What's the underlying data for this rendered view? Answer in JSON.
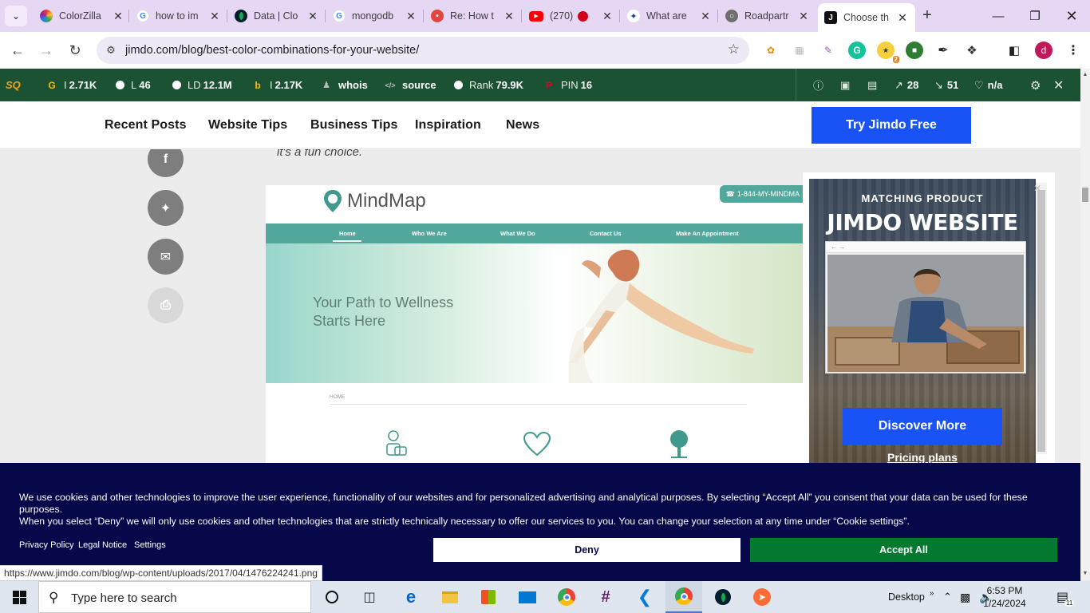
{
  "browser": {
    "tabs": [
      {
        "title": "ColorZilla",
        "icon": "colorzilla-icon",
        "color": "#8b3fd6"
      },
      {
        "title": "how to im",
        "icon": "google-icon",
        "color": "#4285f4"
      },
      {
        "title": "Data | Clo",
        "icon": "mongodb-leaf-icon",
        "color": "#13aa52"
      },
      {
        "title": "mongodb",
        "icon": "google-icon",
        "color": "#4285f4"
      },
      {
        "title": "Re: How t",
        "icon": "community-icon",
        "color": "#e3463c"
      },
      {
        "title": "(270)",
        "icon": "youtube-icon",
        "color": "#ff0000"
      },
      {
        "title": "What are",
        "icon": "roadpartner-icon",
        "color": "#1b3f8b"
      },
      {
        "title": "Roadpartr",
        "icon": "globe-icon",
        "color": "#5f6368"
      },
      {
        "title": "Choose th",
        "icon": "jimdo-icon",
        "color": "#111111",
        "active": true
      }
    ],
    "url": "jimdo.com/blog/best-color-combinations-for-your-website/",
    "profile_initial": "d",
    "status_url": "https://www.jimdo.com/blog/wp-content/uploads/2017/04/1476224241.png"
  },
  "seoquake": {
    "logo": "SQ",
    "items": [
      {
        "icon": "google-icon",
        "label": "I",
        "value": "2.71K"
      },
      {
        "icon": "link-icon",
        "label": "L",
        "value": "46"
      },
      {
        "icon": "link-domain-icon",
        "label": "LD",
        "value": "12.1M"
      },
      {
        "icon": "bing-icon",
        "label": "I",
        "value": "2.17K"
      },
      {
        "icon": "whois-icon",
        "label": "whois",
        "value": ""
      },
      {
        "icon": "source-icon",
        "label": "source",
        "value": ""
      },
      {
        "icon": "rank-icon",
        "label": "Rank",
        "value": "79.9K"
      },
      {
        "icon": "pinterest-icon",
        "label": "PIN",
        "value": "16"
      }
    ],
    "right": {
      "external_links": "28",
      "internal_links": "51",
      "rating": "n/a"
    }
  },
  "site": {
    "nav": [
      "Recent Posts",
      "Website Tips",
      "Business Tips",
      "Inspiration",
      "News"
    ],
    "cta": "Try Jimdo Free",
    "intro_text": "it's a fun choice.",
    "share": [
      "facebook",
      "twitter",
      "email",
      "print"
    ]
  },
  "mindmap": {
    "logo": "MindMap",
    "phone": "1-844-MY-MINDMA",
    "nav": [
      "Home",
      "Who We Are",
      "What We Do",
      "Contact Us",
      "Make An Appointment"
    ],
    "headline_1": "Your Path to Wellness",
    "headline_2": "Starts Here",
    "crumb": "HOME"
  },
  "ad": {
    "kicker": "MATCHING PRODUCT",
    "title": "JIMDO WEBSITE",
    "button": "Discover More",
    "link": "Pricing plans"
  },
  "cookie": {
    "text_1": "We use cookies and other technologies to improve the user experience, functionality of our websites and for personalized advertising and analytical purposes. By selecting “Accept All” you consent that your data can be used for these purposes.",
    "text_2": "When you select “Deny” we will only use cookies and other technologies that are strictly technically necessary to offer our services to you. You can change your selection at any time under “Cookie settings”.",
    "links": [
      "Privacy Policy",
      "Legal Notice",
      "Settings"
    ],
    "deny": "Deny",
    "accept": "Accept All"
  },
  "taskbar": {
    "search_placeholder": "Type here to search",
    "desktop_label": "Desktop",
    "time": "6:53 PM",
    "date": "1/24/2024",
    "notification_count": "11"
  }
}
